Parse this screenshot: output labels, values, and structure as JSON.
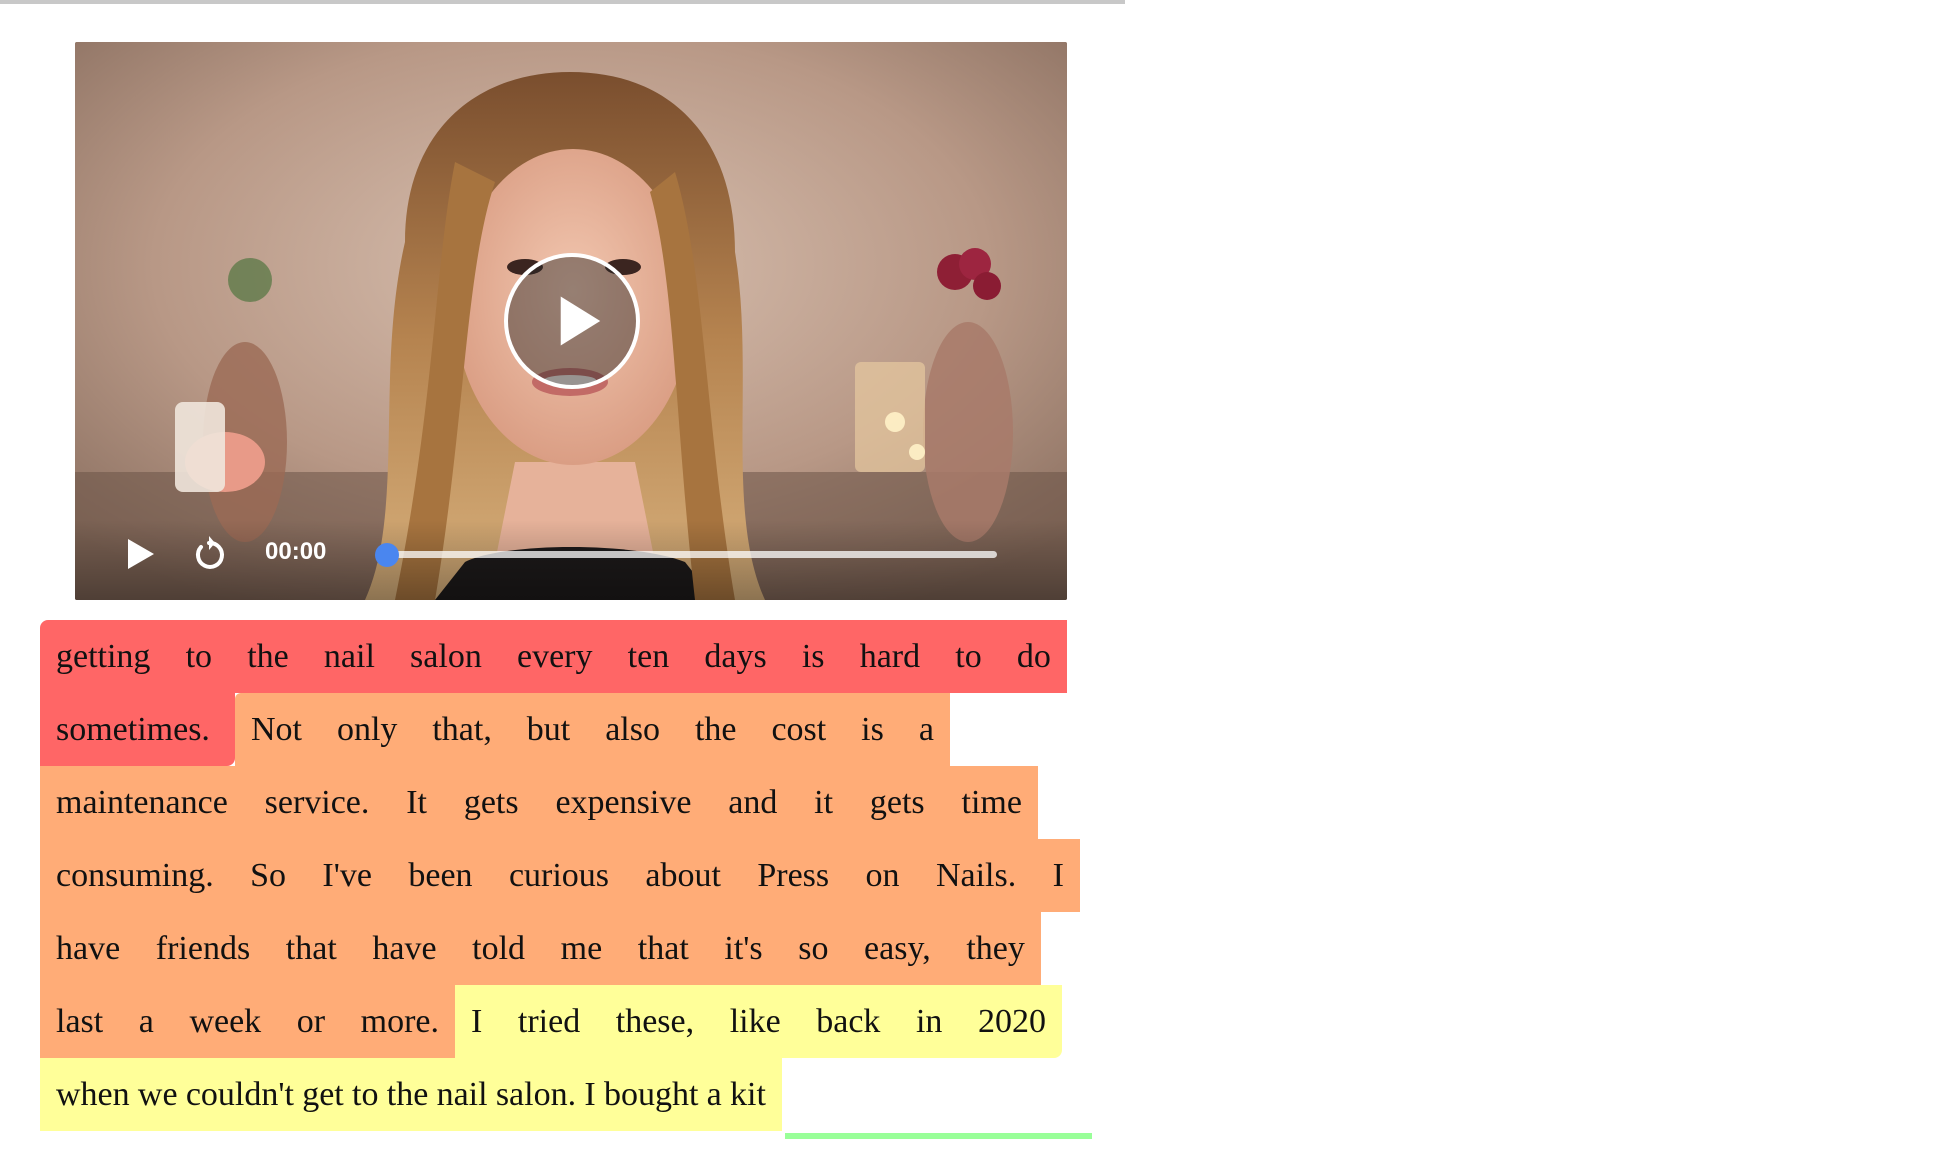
{
  "colors": {
    "segment_1": "#ff6666",
    "segment_2": "#ffac77",
    "segment_3": "#ffff99",
    "segment_4": "#99ff99",
    "progress": "#4a86ef",
    "control_icons": "#ffffff"
  },
  "video": {
    "big_play_icon": "play-circle-icon",
    "play_icon": "play-icon",
    "replay_icon": "replay-icon",
    "time": "00:00",
    "progress_fraction": 0
  },
  "transcript": {
    "lines": [
      {
        "segments": [
          {
            "color": "segment_1",
            "words": [
              "getting",
              "to",
              "the",
              "nail",
              "salon",
              "every",
              "ten",
              "days",
              "is",
              "hard",
              "to",
              "do"
            ]
          }
        ]
      },
      {
        "segments": [
          {
            "color": "segment_1",
            "words": [
              "sometimes."
            ]
          },
          {
            "color": "segment_2",
            "words": [
              "Not",
              "only",
              "that,",
              "but",
              "also",
              "the",
              "cost",
              "is",
              "a"
            ]
          }
        ]
      },
      {
        "segments": [
          {
            "color": "segment_2",
            "words": [
              "maintenance",
              "service.",
              "It",
              "gets",
              "expensive",
              "and",
              "it",
              "gets",
              "time"
            ]
          }
        ]
      },
      {
        "segments": [
          {
            "color": "segment_2",
            "words": [
              "consuming.",
              "So",
              "I've",
              "been",
              "curious",
              "about",
              "Press",
              "on",
              "Nails.",
              "I"
            ]
          }
        ]
      },
      {
        "segments": [
          {
            "color": "segment_2",
            "words": [
              "have",
              "friends",
              "that",
              "have",
              "told",
              "me",
              "that",
              "it's",
              "so",
              "easy,",
              "they"
            ]
          }
        ]
      },
      {
        "segments": [
          {
            "color": "segment_2",
            "words": [
              "last",
              "a",
              "week",
              "or",
              "more."
            ]
          },
          {
            "color": "segment_3",
            "words": [
              "I",
              "tried",
              "these,",
              "like",
              "back",
              "in",
              "2020"
            ]
          }
        ]
      },
      {
        "segments": [
          {
            "color": "segment_3",
            "words": [
              "when",
              "we",
              "couldn't",
              "get",
              "to",
              "the",
              "nail",
              "salon.",
              "I",
              "bought",
              "a",
              "kit"
            ]
          },
          {
            "color": "segment_4",
            "words": []
          }
        ]
      }
    ]
  }
}
